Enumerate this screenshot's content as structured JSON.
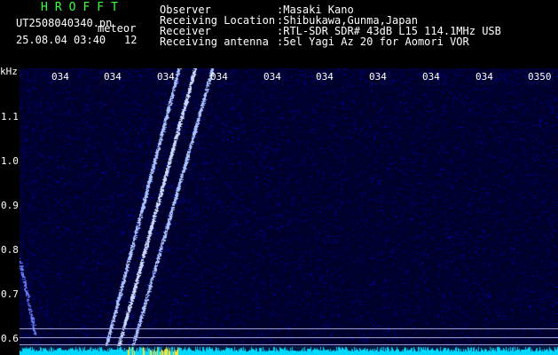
{
  "header": {
    "app_title": "HROFFT",
    "filename": "UT2508040340.pn",
    "mode_label": "meteor",
    "datetime": "25.08.04 03:40",
    "count": "12",
    "fields": [
      {
        "label": "Observer",
        "value": ":Masaki Kano"
      },
      {
        "label": "Receiving Location",
        "value": ":Shibukawa,Gunma,Japan"
      },
      {
        "label": "Receiver",
        "value": ":RTL-SDR SDR# 43dB L15 114.1MHz USB"
      },
      {
        "label": "Receiving antenna",
        "value": ":5el Yagi Az 20 for Aomori VOR"
      }
    ]
  },
  "axis": {
    "unit": "kHz",
    "y_ticks": [
      "1.1",
      "1.0",
      "0.9",
      "0.8",
      "0.7",
      "0.6"
    ],
    "x_ticks": [
      "034",
      "034",
      "034",
      "034",
      "034",
      "034",
      "034",
      "034",
      "034",
      "0350"
    ]
  },
  "colors": {
    "title": "#3cff3c",
    "text": "#ffffff",
    "background": "#000000",
    "noise": "#0000ff",
    "trail": "#b0c8ff",
    "baseline": "#00d8ff"
  }
}
